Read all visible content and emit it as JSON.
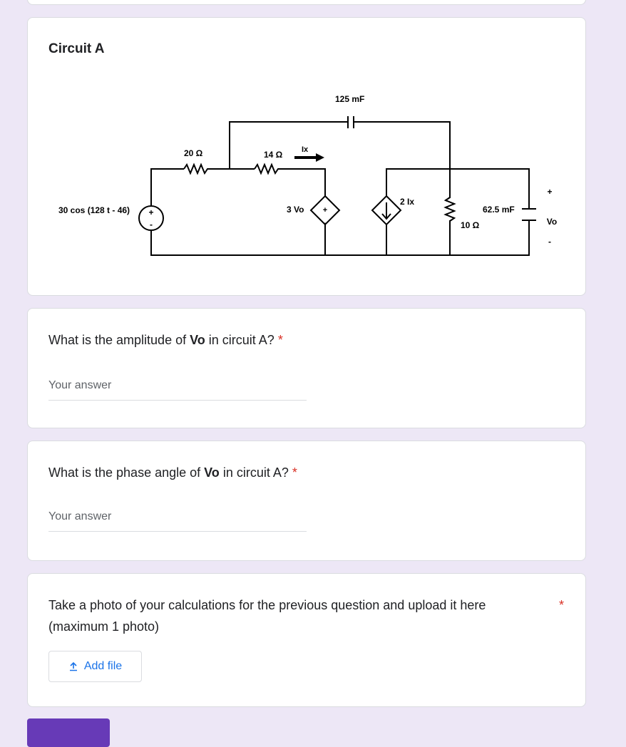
{
  "circuit_card": {
    "title": "Circuit A",
    "labels": {
      "source": "30 cos (128 t - 46)",
      "r20": "20 Ω",
      "r14": "14 Ω",
      "ix": "Ix",
      "cap125": "125 mF",
      "dep_v": "3 Vo",
      "dep_i": "2 Ix",
      "r10": "10 Ω",
      "cap62": "62.5 mF",
      "vo": "Vo",
      "plus": "+",
      "minus": "-"
    }
  },
  "q1": {
    "prefix": "What is the amplitude of ",
    "bold": "Vo",
    "suffix": " in circuit A?",
    "required_mark": "*",
    "placeholder": "Your answer"
  },
  "q2": {
    "prefix": "What is the phase angle of ",
    "bold": "Vo",
    "suffix": " in circuit A?",
    "required_mark": "*",
    "placeholder": "Your answer"
  },
  "q3": {
    "line1": "Take a photo of your calculations for the previous question and upload it here",
    "line2": "(maximum 1 photo)",
    "required_mark": "*",
    "add_file_label": "Add file"
  },
  "colors": {
    "background": "#ede7f6",
    "accent": "#673ab7",
    "link": "#1a73e8",
    "required": "#d93025"
  },
  "icons": {
    "upload": "upload-icon"
  }
}
